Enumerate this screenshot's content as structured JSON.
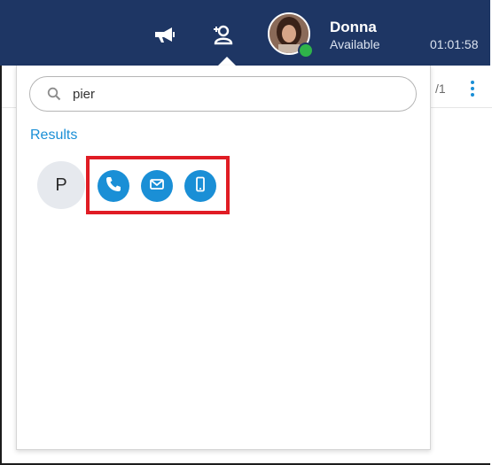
{
  "header": {
    "user_name": "Donna",
    "user_status": "Available",
    "clock": "01:01:58",
    "icons": [
      "megaphone-icon",
      "contacts-icon"
    ],
    "presence_color": "#2fb34a",
    "bar_color": "#1e3664"
  },
  "toolbar": {
    "page_count": "/1"
  },
  "search": {
    "value": "pier",
    "placeholder": ""
  },
  "results": {
    "label": "Results",
    "items": [
      {
        "initial": "P",
        "actions": [
          "phone-icon",
          "email-icon",
          "mobile-icon"
        ]
      }
    ]
  },
  "accent_color": "#1a8fd6",
  "highlight_color": "#e01c24"
}
